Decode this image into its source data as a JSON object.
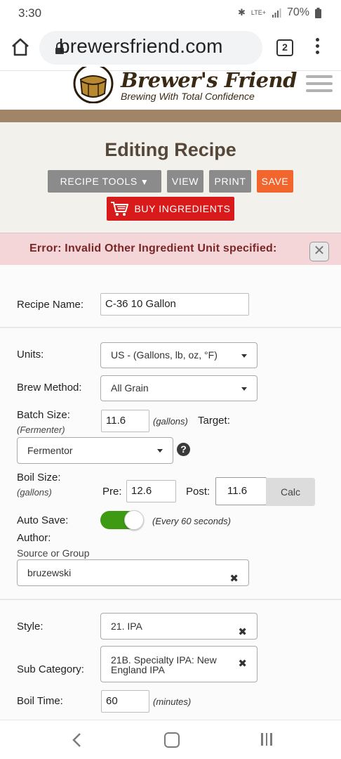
{
  "status_bar": {
    "time": "3:30",
    "network": "LTE+",
    "battery": "70%"
  },
  "browser": {
    "url": "brewersfriend.com",
    "tab_count": "2"
  },
  "site": {
    "logo_title": "Brewer's Friend",
    "logo_tagline": "Brewing With Total Confidence"
  },
  "page": {
    "title": "Editing Recipe",
    "buttons": {
      "recipe_tools": "RECIPE TOOLS",
      "view": "VIEW",
      "print": "PRINT",
      "save": "SAVE",
      "buy_ingredients": "BUY INGREDIENTS"
    },
    "error_message": "Error: Invalid Other Ingredient Unit specified:"
  },
  "form": {
    "recipe_name": {
      "label": "Recipe Name:",
      "value": "C-36 10 Gallon"
    },
    "units": {
      "label": "Units:",
      "value": "US - (Gallons, lb, oz, °F)"
    },
    "brew_method": {
      "label": "Brew Method:",
      "value": "All Grain"
    },
    "batch_size": {
      "label": "Batch Size:",
      "sublabel": "(Fermenter)",
      "value": "11.6",
      "unit": "(gallons)",
      "target_label": "Target:",
      "target_value": "Fermentor"
    },
    "boil_size": {
      "label": "Boil Size:",
      "sublabel": "(gallons)",
      "pre_label": "Pre:",
      "pre_value": "12.6",
      "post_label": "Post:",
      "post_value": "11.6",
      "calc_label": "Calc"
    },
    "auto_save": {
      "label": "Auto Save:",
      "enabled": true,
      "note": "(Every 60 seconds)"
    },
    "author": {
      "label": "Author:",
      "sublabel": "Source or Group",
      "value": "bruzewski"
    },
    "style": {
      "label": "Style:",
      "value": "21. IPA"
    },
    "sub_category": {
      "label": "Sub Category:",
      "value_line1": "21B. Specialty IPA: New",
      "value_line2": "England IPA"
    },
    "boil_time": {
      "label": "Boil Time:",
      "value": "60",
      "unit": "(minutes)"
    }
  },
  "colors": {
    "save": "#f2652c",
    "buy": "#d91a1a",
    "toggle_on": "#3d9a12",
    "error_bg": "#f4d6d8",
    "brand_brown": "#a08666"
  }
}
